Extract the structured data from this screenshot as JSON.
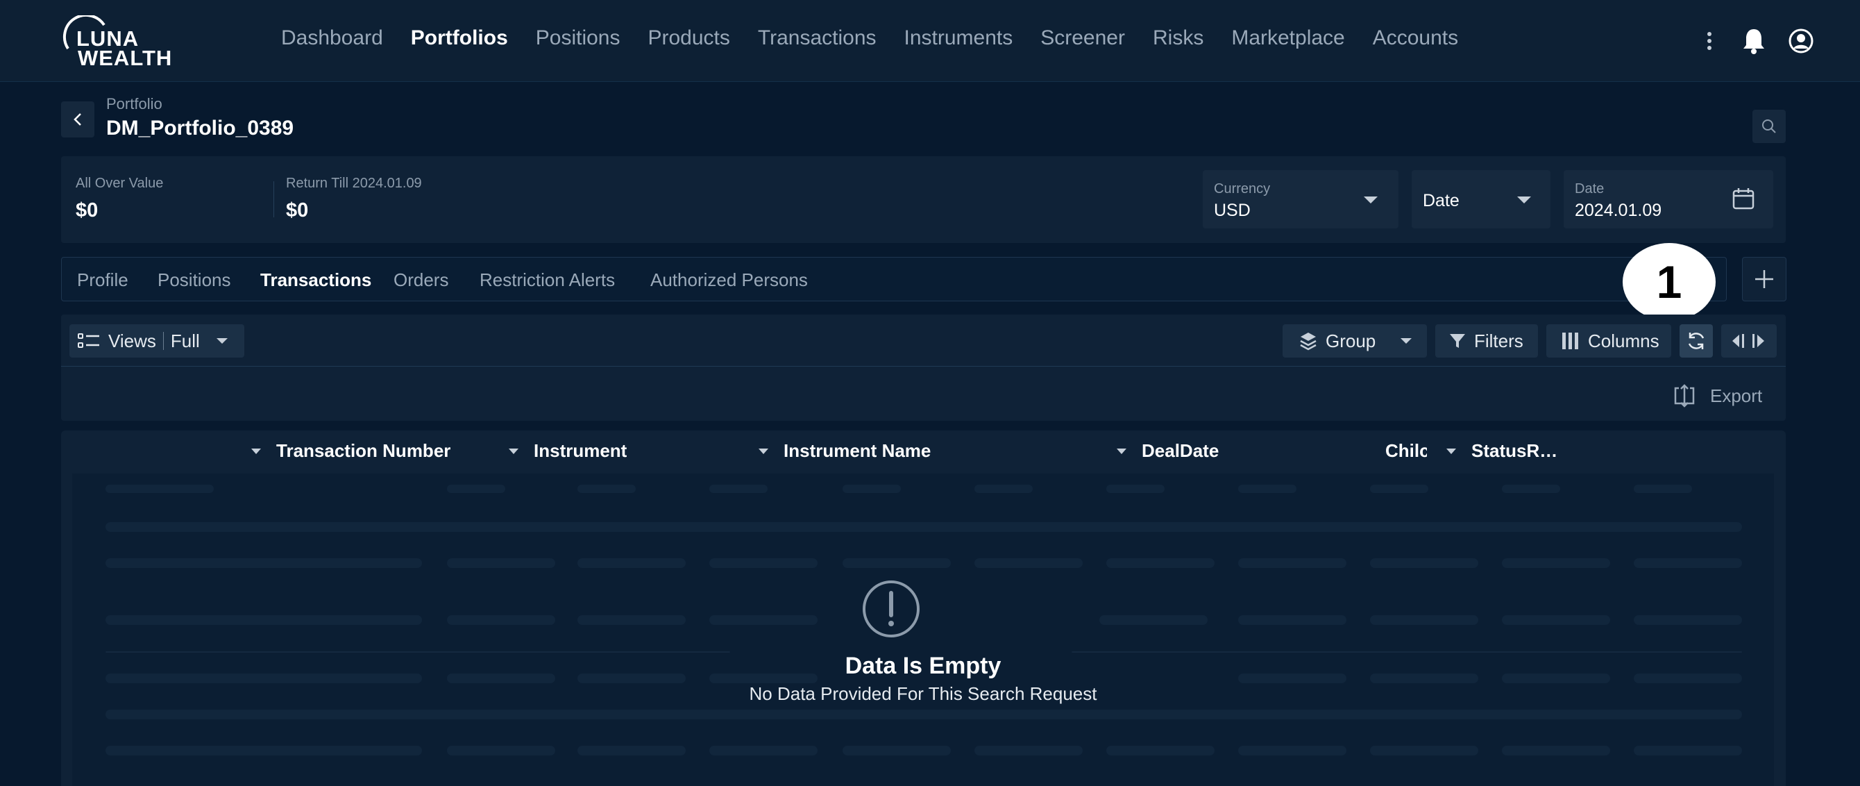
{
  "brand": {
    "line1": "LUNA",
    "line2": "WEALTH"
  },
  "nav": [
    {
      "label": "Dashboard",
      "active": false
    },
    {
      "label": "Portfolios",
      "active": true
    },
    {
      "label": "Positions",
      "active": false
    },
    {
      "label": "Products",
      "active": false
    },
    {
      "label": "Transactions",
      "active": false
    },
    {
      "label": "Instruments",
      "active": false
    },
    {
      "label": "Screener",
      "active": false
    },
    {
      "label": "Risks",
      "active": false
    },
    {
      "label": "Marketplace",
      "active": false
    },
    {
      "label": "Accounts",
      "active": false
    }
  ],
  "top_icons": [
    "more-vertical-icon",
    "bell-icon",
    "user-avatar-icon"
  ],
  "header": {
    "breadcrumb": "Portfolio",
    "title": "DM_Portfolio_0389"
  },
  "summary": {
    "all_over_value_label": "All Over Value",
    "all_over_value": "$0",
    "return_label": "Return Till 2024.01.09",
    "return_value": "$0"
  },
  "filters": {
    "currency_label": "Currency",
    "currency_value": "USD",
    "date_mode_value": "Date",
    "date_label": "Date",
    "date_value": "2024.01.09"
  },
  "tabs": [
    {
      "label": "Profile",
      "active": false
    },
    {
      "label": "Positions",
      "active": false
    },
    {
      "label": "Transactions",
      "active": true
    },
    {
      "label": "Orders",
      "active": false
    },
    {
      "label": "Restriction Alerts",
      "active": false
    },
    {
      "label": "Authorized Persons",
      "active": false
    }
  ],
  "annotation_badge": "1",
  "toolbar": {
    "views_label": "Views",
    "views_value": "Full",
    "group_label": "Group",
    "filters_label": "Filters",
    "columns_label": "Columns",
    "export_label": "Export"
  },
  "table": {
    "columns": [
      "Transaction Number",
      "Instrument",
      "Instrument Name",
      "DealDate",
      "Chilc",
      "StatusR…"
    ],
    "rows": []
  },
  "empty_state": {
    "title": "Data Is Empty",
    "subtitle": "No Data Provided For This Search Request"
  },
  "colors": {
    "background": "#07192e",
    "panel": "#0f2237",
    "accent_text": "#ffffff",
    "muted_text": "#8c9bab"
  }
}
